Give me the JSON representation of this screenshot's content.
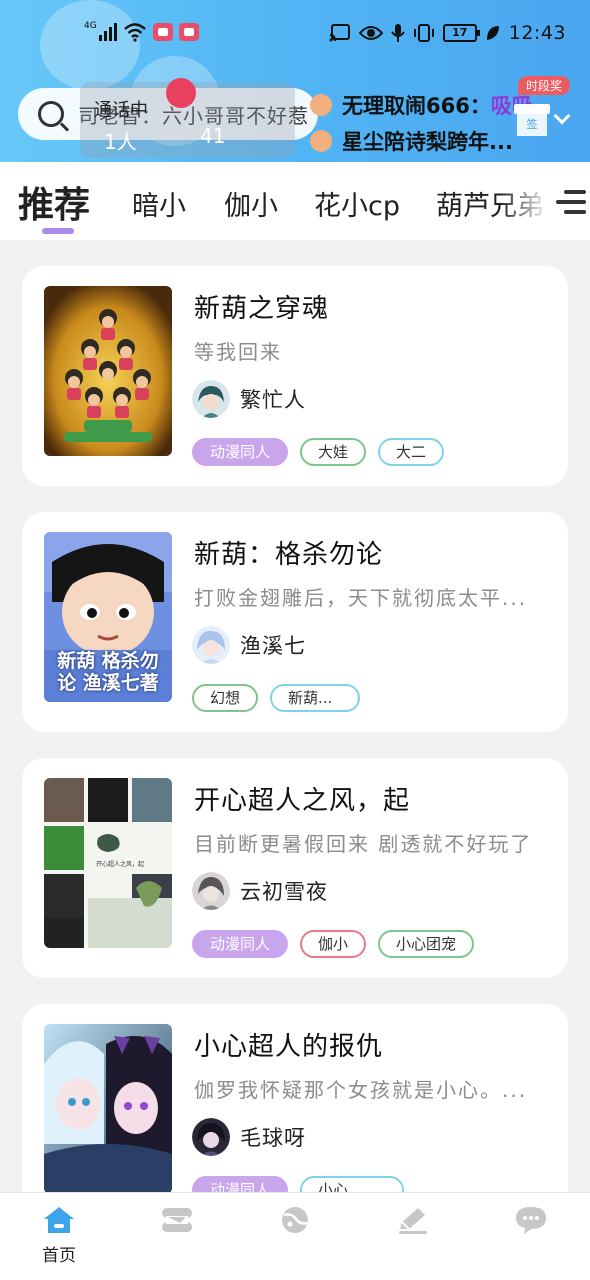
{
  "status_bar": {
    "network": "4G",
    "battery": "17",
    "time": "12:43"
  },
  "search": {
    "text": "司老智：六小哥哥不好惹"
  },
  "call_overlay": {
    "label": "通话中",
    "count": "1人",
    "heart_count": "41"
  },
  "danmaku": [
    {
      "user": "无理取闹",
      "suffix": "666：",
      "extra": "吸吸"
    },
    {
      "text": "星尘陪诗梨跨年..."
    }
  ],
  "gift": {
    "tag": "时段奖",
    "box_label": "签"
  },
  "tabs": {
    "items": [
      "推荐",
      "暗小",
      "伽小",
      "花小cp",
      "葫芦兄弟"
    ],
    "active": "推荐"
  },
  "cards": [
    {
      "title": "新葫之穿魂",
      "desc": "等我回来",
      "author": "繁忙人",
      "tags": [
        {
          "label": "动漫同人",
          "style": "filled"
        },
        {
          "label": "大娃",
          "style": "green"
        },
        {
          "label": "大二",
          "style": "cyan"
        }
      ]
    },
    {
      "title": "新葫：格杀勿论",
      "desc": "打败金翅雕后，天下就彻底太平...",
      "author": "渔溪七",
      "cover_text": "新葫 格杀勿论 渔溪七著",
      "tags": [
        {
          "label": "幻想",
          "style": "green"
        },
        {
          "label": "新葫...",
          "style": "cyan"
        }
      ]
    },
    {
      "title": "开心超人之风，起",
      "desc": "目前断更暑假回来 剧透就不好玩了",
      "author": "云初雪夜",
      "tags": [
        {
          "label": "动漫同人",
          "style": "filled"
        },
        {
          "label": "伽小",
          "style": "red"
        },
        {
          "label": "小心团宠",
          "style": "green"
        }
      ]
    },
    {
      "title": "小心超人的报仇",
      "desc": "伽罗我怀疑那个女孩就是小心。...",
      "author": "毛球呀",
      "tags": [
        {
          "label": "动漫同人",
          "style": "filled"
        },
        {
          "label": "小心...",
          "style": "cyan"
        }
      ]
    }
  ],
  "bottom_nav": {
    "home_label": "首页",
    "icons": [
      "home-icon",
      "stack-icon",
      "planet-icon",
      "pen-icon",
      "message-icon"
    ]
  },
  "colors": {
    "header_start": "#67c8f8",
    "header_end": "#4aa6f0",
    "accent_purple": "#a98ae8",
    "home_blue": "#3ca5ec",
    "nav_gray": "#c7c7c7"
  }
}
